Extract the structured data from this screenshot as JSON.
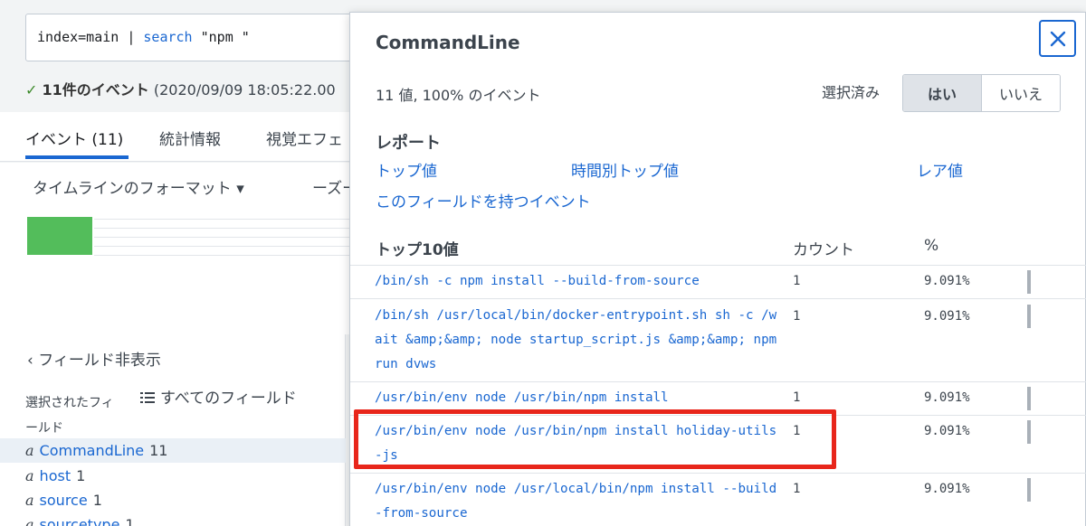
{
  "search": {
    "prefix": "index=main | ",
    "keyword": "search",
    "suffix": " \"npm \""
  },
  "status": {
    "check": "✓",
    "count_text": "11件のイベント",
    "time_text": "(2020/09/09 18:05:22.00"
  },
  "tabs": [
    {
      "label": "イベント (11)"
    },
    {
      "label": "統計情報"
    },
    {
      "label": "視覚エフェ"
    }
  ],
  "timeline": {
    "format_label": "タイムラインのフォーマット ▾",
    "zoom_label": "ーズー"
  },
  "sidebar": {
    "hide_fields": "‹ フィールド非表示",
    "selected_fields": "選択されたフィールド",
    "all_fields": "すべてのフィールド",
    "fields": [
      {
        "type": "a",
        "name": "CommandLine",
        "count": "11"
      },
      {
        "type": "a",
        "name": "host",
        "count": "1"
      },
      {
        "type": "a",
        "name": "source",
        "count": "1"
      },
      {
        "type": "a",
        "name": "sourcetype",
        "count": "1"
      }
    ]
  },
  "popup": {
    "title": "CommandLine",
    "summary": "11 値, 100% のイベント",
    "selected_label": "選択済み",
    "yes_label": "はい",
    "no_label": "いいえ",
    "report_title": "レポート",
    "links": {
      "top_values": "トップ値",
      "top_by_time": "時間別トップ値",
      "rare_values": "レア値",
      "events_with_field": "このフィールドを持つイベント"
    },
    "table": {
      "col_value": "トップ10値",
      "col_count": "カウント",
      "col_pct": "%",
      "rows": [
        {
          "value": "/bin/sh -c npm install --build-from-source",
          "count": "1",
          "pct": "9.091%"
        },
        {
          "value": "/bin/sh /usr/local/bin/docker-entrypoint.sh sh -c /wait &amp;&amp; node startup_script.js &amp;&amp; npm run dvws",
          "count": "1",
          "pct": "9.091%"
        },
        {
          "value": "/usr/bin/env node /usr/bin/npm install",
          "count": "1",
          "pct": "9.091%"
        },
        {
          "value": "/usr/bin/env node /usr/bin/npm install holiday-utils-js",
          "count": "1",
          "pct": "9.091%"
        },
        {
          "value": "/usr/bin/env node /usr/local/bin/npm install --build-from-source",
          "count": "1",
          "pct": "9.091%"
        }
      ]
    }
  },
  "colors": {
    "link": "#1a67d1",
    "timeline_bar": "#53bd5b",
    "highlight": "#e8261b"
  }
}
